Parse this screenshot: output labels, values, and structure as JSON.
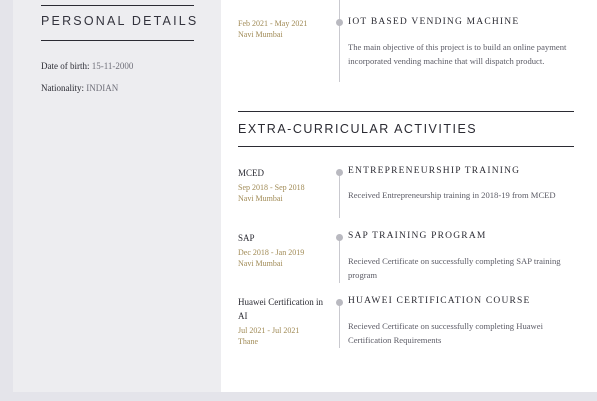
{
  "sidebar": {
    "heading": "PERSONAL DETAILS",
    "details": [
      {
        "label": "Date of birth:",
        "value": "15-11-2000"
      },
      {
        "label": "Nationality:",
        "value": "INDIAN"
      }
    ]
  },
  "project": {
    "date": "Feb 2021 - May 2021",
    "location": "Navi Mumbai",
    "title": "IOT BASED VENDING MACHINE",
    "description": "The main objective of this project is to build an online payment incorporated vending machine that will dispatch product."
  },
  "activities": {
    "title": "EXTRA-CURRICULAR ACTIVITIES",
    "items": [
      {
        "org": "MCED",
        "date": "Sep 2018 - Sep 2018",
        "location": "Navi Mumbai",
        "title": "ENTREPRENEURSHIP TRAINING",
        "description": "Received Entrepreneurship training in 2018-19 from MCED"
      },
      {
        "org": "SAP",
        "date": "Dec 2018 - Jan 2019",
        "location": "Navi Mumbai",
        "title": "SAP TRAINING PROGRAM",
        "description": "Recieved Certificate on successfully completing SAP training program"
      },
      {
        "org": "Huawei Certification in AI",
        "date": "Jul 2021 - Jul 2021",
        "location": "Thane",
        "title": "HUAWEI CERTIFICATION COURSE",
        "description": "Recieved Certificate on successfully completing Huawei Certification Requirements"
      }
    ]
  },
  "colors": {
    "sidebar_bg": "#ededf0",
    "accent_date": "#a08a55",
    "text_dark": "#2b2b33",
    "page_bg": "#e4e4ea"
  }
}
